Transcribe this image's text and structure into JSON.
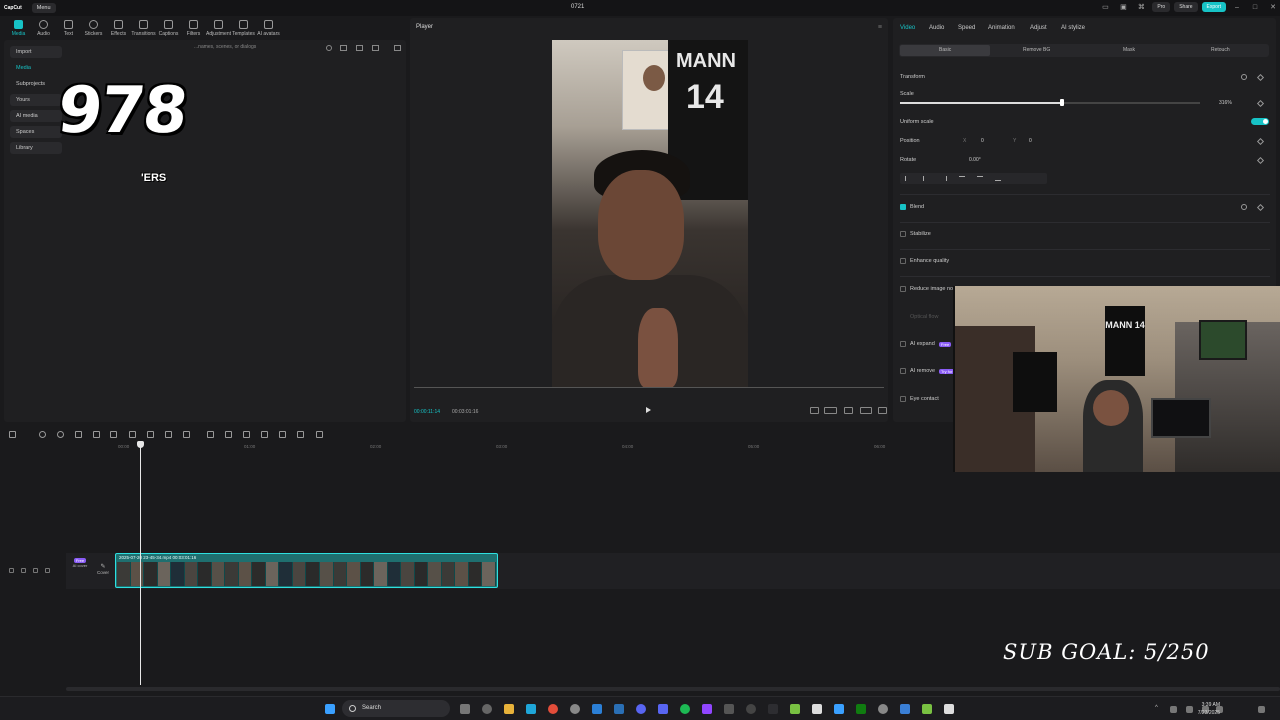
{
  "app": {
    "logo": "CapCut",
    "menu_label": "Menu",
    "project_name": "0721",
    "pro_label": "Pro",
    "share_label": "Share",
    "export_label": "Export"
  },
  "toolbar": {
    "tools": [
      {
        "label": "Media",
        "icon": "media-icon"
      },
      {
        "label": "Audio",
        "icon": "audio-icon"
      },
      {
        "label": "Text",
        "icon": "text-icon"
      },
      {
        "label": "Stickers",
        "icon": "stickers-icon"
      },
      {
        "label": "Effects",
        "icon": "effects-icon"
      },
      {
        "label": "Transitions",
        "icon": "transitions-icon"
      },
      {
        "label": "Captions",
        "icon": "captions-icon"
      },
      {
        "label": "Filters",
        "icon": "filters-icon"
      },
      {
        "label": "Adjustment",
        "icon": "adjustment-icon"
      },
      {
        "label": "Templates",
        "icon": "templates-icon"
      },
      {
        "label": "AI avatars",
        "icon": "ai-avatars-icon"
      }
    ]
  },
  "media_panel": {
    "sidebar": [
      "Import",
      "Media",
      "Subprojects",
      "Yours",
      "AI media",
      "Spaces",
      "Library"
    ],
    "search_placeholder": "...names, scenes, or dialogs",
    "overlay_number": "978",
    "overlay_suffix": "'ERS"
  },
  "player": {
    "title": "Player",
    "current_time": "00:00:11:14",
    "total_time": "00:03:01:16",
    "jersey_name": "MANN",
    "jersey_number": "14"
  },
  "properties": {
    "tabs": [
      "Video",
      "Audio",
      "Speed",
      "Animation",
      "Adjust",
      "AI stylize"
    ],
    "subtabs": [
      "Basic",
      "Remove BG",
      "Mask",
      "Retouch"
    ],
    "transform_label": "Transform",
    "scale_label": "Scale",
    "scale_value": "316%",
    "scale_level": 0.54,
    "uniform_scale_label": "Uniform scale",
    "position_label": "Position",
    "position_x_prefix": "X",
    "position_x": "0",
    "position_y_prefix": "Y",
    "position_y": "0",
    "rotate_label": "Rotate",
    "rotate_value": "0.00°",
    "blend_label": "Blend",
    "stabilize_label": "Stabilize",
    "enhance_label": "Enhance quality",
    "reduce_noise_label": "Reduce image no",
    "optical_flow_label": "Optical flow",
    "ai_expand_label": "AI expand",
    "ai_expand_badge": "Free",
    "ai_remove_label": "AI remove",
    "ai_remove_badge": "Try for",
    "eye_contact_label": "Eye contact"
  },
  "timeline": {
    "ruler": [
      "00:00",
      "01:00",
      "02:00",
      "03:00",
      "04:00",
      "05:00",
      "06:00"
    ],
    "clip_label": "2025-07-20 23-45-34.mp4  00:03:01:16",
    "cover_label": "Cover",
    "ai_badge": "Free",
    "ai_label": "AI cover"
  },
  "stream_overlay": {
    "sub_goal": "SUB GOAL: 5/250",
    "webcam_jersey": "MANN 14"
  },
  "taskbar": {
    "search_label": "Search",
    "time": "3:39 AM",
    "date": "7/23/2025"
  },
  "colors": {
    "accent": "#17c3c6",
    "ai_badge": "#8a5cf6"
  }
}
